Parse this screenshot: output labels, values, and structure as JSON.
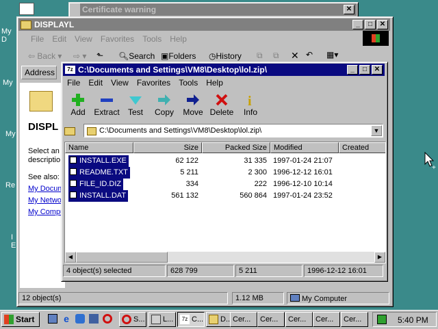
{
  "desktop": {
    "icon_labels": [
      "My D",
      "My",
      "My",
      "Re",
      "I",
      "E"
    ]
  },
  "cert_window": {
    "title": "Certificate warning",
    "close": "✕"
  },
  "explorer": {
    "title": "DISPLAYL",
    "menu": [
      "File",
      "Edit",
      "View",
      "Favorites",
      "Tools",
      "Help"
    ],
    "toolbar": {
      "back": "Back",
      "search": "Search",
      "folders": "Folders",
      "history": "History"
    },
    "address_label": "Address",
    "panel_title": "DISPL",
    "panel_text": [
      "Select an i",
      "descriptio"
    ],
    "see_also": "See also:",
    "links": [
      "My Docum",
      "My Netwo",
      "My Compu"
    ],
    "status": {
      "count": "12 object(s)",
      "size": "1.12 MB",
      "zone": "My Computer"
    }
  },
  "zip": {
    "title": "C:\\Documents and Settings\\VM8\\Desktop\\lol.zip\\",
    "menu": [
      "File",
      "Edit",
      "View",
      "Favorites",
      "Tools",
      "Help"
    ],
    "tools": [
      {
        "label": "Add",
        "icon": "add-icon"
      },
      {
        "label": "Extract",
        "icon": "extract-icon"
      },
      {
        "label": "Test",
        "icon": "test-icon"
      },
      {
        "label": "Copy",
        "icon": "copy-icon"
      },
      {
        "label": "Move",
        "icon": "move-icon"
      },
      {
        "label": "Delete",
        "icon": "delete-icon"
      },
      {
        "label": "Info",
        "icon": "info-icon"
      }
    ],
    "path": "C:\\Documents and Settings\\VM8\\Desktop\\lol.zip\\",
    "columns": [
      "Name",
      "Size",
      "Packed Size",
      "Modified",
      "Created"
    ],
    "files": [
      {
        "name": "INSTALL.EXE",
        "size": "62 122",
        "packed": "31 335",
        "modified": "1997-01-24 21:07"
      },
      {
        "name": "README.TXT",
        "size": "5 211",
        "packed": "2 300",
        "modified": "1996-12-12 16:01"
      },
      {
        "name": "FILE_ID.DIZ",
        "size": "334",
        "packed": "222",
        "modified": "1996-12-10 10:14"
      },
      {
        "name": "INSTALL.DAT",
        "size": "561 132",
        "packed": "560 864",
        "modified": "1997-01-24 23:52"
      }
    ],
    "status": {
      "selected": "4 object(s) selected",
      "total": "628 799",
      "size": "5 211",
      "date": "1996-12-12 16:01"
    }
  },
  "taskbar": {
    "start": "Start",
    "tasks": [
      "S...",
      "L...",
      "C...",
      "D...",
      "Cer...",
      "Cer...",
      "Cer...",
      "Cer...",
      "Cer..."
    ],
    "clock": "5:40 PM"
  },
  "colors": {
    "title_active": "#0a0a80",
    "desktop": "#3a8a8a"
  }
}
